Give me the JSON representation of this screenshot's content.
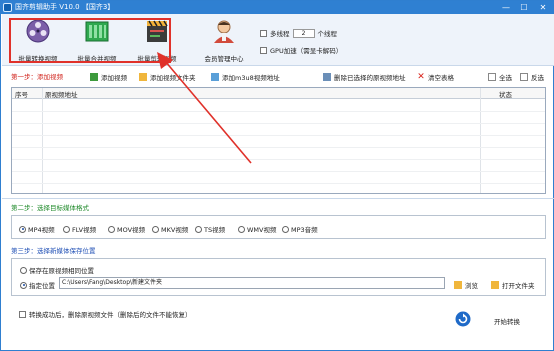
{
  "title_bar": {
    "title": "国齐剪辑助手 V10.0 【国齐3】",
    "minimize": "—",
    "maximize": "☐",
    "close": "✕"
  },
  "toolbar": {
    "buttons": [
      {
        "label": "批量转换视频",
        "icon": "film-reel-icon"
      },
      {
        "label": "批量合并视频",
        "icon": "green-blocks-icon"
      },
      {
        "label": "批量剪辑视频",
        "icon": "clapperboard-icon"
      },
      {
        "label": "会员管理中心",
        "icon": "member-avatar-icon"
      }
    ],
    "multithread_label": "多线程",
    "thread_count": "2",
    "thread_unit": "个线程",
    "gpu_label": "GPU加速（需显卡解码）"
  },
  "step1": {
    "label": "第一步：添加视频",
    "add_video": "添加视频",
    "add_folder": "添加视频文件夹",
    "add_m3u8": "添加m3u8视频地址",
    "delete_selected": "删除已选择的原视频地址",
    "clear_table": "清空表格",
    "select_all": "全选",
    "invert": "反选"
  },
  "table": {
    "columns": [
      "序号",
      "原视频地址",
      "状态"
    ],
    "rows": []
  },
  "step2": {
    "label": "第二步：选择目标媒体格式",
    "formats": [
      "MP4视频",
      "FLV视频",
      "MOV视频",
      "MKV视频",
      "TS视频",
      "WMV视频",
      "MP3音频"
    ],
    "selected": "MP4视频"
  },
  "step3": {
    "label": "第三步：选择新媒体保存位置",
    "option_same": "保存在原视频相同位置",
    "option_custom": "指定位置",
    "path": "C:\\Users\\Fang\\Desktop\\新建文件夹",
    "browse": "浏览",
    "open_folder": "打开文件夹"
  },
  "footer": {
    "delete_after": "转换成功后，删除原视频文件（删除后的文件不能恢复）",
    "start": "开始转换"
  },
  "colors": {
    "title_blue": "#2f80d2",
    "annotation_red": "#e0312a"
  }
}
